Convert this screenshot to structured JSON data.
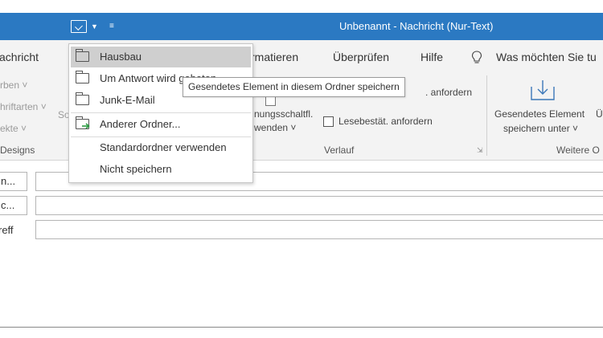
{
  "window": {
    "title": "Unbenannt  -  Nachricht (Nur-Text)",
    "accent_color": "#2b79c2"
  },
  "quick_access": {
    "save_icon": "save-to-folder-icon",
    "dropdown_icon": "chevron-down-icon",
    "customize_icon": "customize-qat-icon"
  },
  "ribbon_tabs": {
    "nachricht": "achricht",
    "formatieren": "rmatieren",
    "ueberpruefen": "Überprüfen",
    "hilfe": "Hilfe",
    "search_icon": "lightbulb-icon",
    "search": "Was möchten Sie tu"
  },
  "ribbon": {
    "farben": "rben ˅",
    "schriftarten": "hriftarten ˅",
    "effekte": "ekte ˅",
    "so_frag": "So",
    "abstimm_1": "nungsschaltfl.",
    "abstimm_2": "wenden ˅",
    "anfordern_1": ". anfordern",
    "lesebestaet": "Lesebestät. anfordern",
    "save_sent_1": "Gesendetes Element",
    "save_sent_2": "speichern unter ˅",
    "save_sent_cut": "Ü",
    "group_designs": "Designs",
    "group_verlauf": "Verlauf",
    "group_weitere": "Weitere O"
  },
  "fields": {
    "an": "n...",
    "cc": "c...",
    "betreff": "reff"
  },
  "dropdown": {
    "items": [
      {
        "label": "Hausbau",
        "icon": "folder-icon",
        "selected": true
      },
      {
        "label": "Um Antwort wird gebeten",
        "icon": "folder-icon",
        "selected": false
      },
      {
        "label": "Junk-E-Mail",
        "icon": "folder-icon",
        "selected": false
      },
      {
        "label": "Anderer Ordner...",
        "icon": "other-folder-icon",
        "selected": false
      },
      {
        "label": "Standardordner verwenden",
        "icon": "",
        "selected": false
      },
      {
        "label": "Nicht speichern",
        "icon": "",
        "selected": false
      }
    ]
  },
  "tooltip": {
    "text": "Gesendetes Element in diesem Ordner speichern"
  }
}
